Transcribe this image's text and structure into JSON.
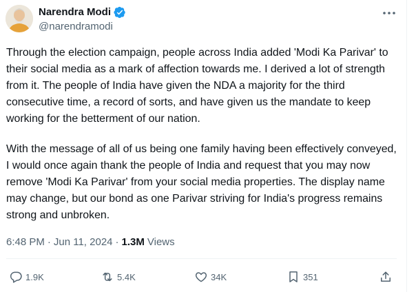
{
  "author": {
    "name": "Narendra Modi",
    "handle": "@narendramodi",
    "verified": true
  },
  "tweet": {
    "paragraphs": [
      "Through the election campaign, people across India added 'Modi Ka Parivar' to their social media as a mark of affection towards me. I derived a lot of strength from it. The people of India have given the NDA a majority for the third consecutive time, a record of sorts, and have given us the mandate to keep working for the betterment of our nation.",
      "With the message of all of us being one family having been effectively conveyed, I would once again thank the people of India and request that you may now remove 'Modi Ka Parivar' from your social media properties. The display name may change, but our bond as one Parivar striving for India's progress remains strong and unbroken."
    ],
    "time": "6:48 PM",
    "separator": "·",
    "date": "Jun 11, 2024",
    "views_count": "1.3M",
    "views_label": "Views"
  },
  "actions": {
    "replies": "1.9K",
    "reposts": "5.4K",
    "likes": "34K",
    "bookmarks": "351"
  },
  "icons": {
    "verified": "verified-badge-icon",
    "more": "more-horizontal-icon",
    "reply": "reply-bubble-icon",
    "repost": "repost-arrows-icon",
    "like": "heart-icon",
    "bookmark": "bookmark-icon",
    "share": "share-upload-icon"
  },
  "colors": {
    "verified": "#1d9bf0",
    "text": "#0f1419",
    "secondary": "#536471"
  }
}
